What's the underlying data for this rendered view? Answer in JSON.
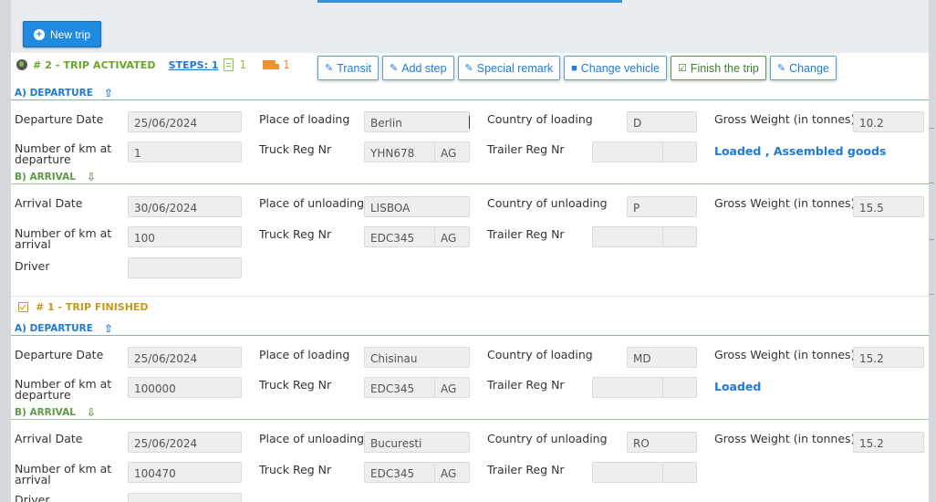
{
  "toolbar": {
    "new_trip": "New trip"
  },
  "trip2": {
    "title": "# 2 - TRIP ACTIVATED",
    "steps": "STEPS: 1",
    "docs_count": "1",
    "vehicles_count": "1",
    "actions": [
      "Transit",
      "Add step",
      "Special remark",
      "Change vehicle",
      "Finish the trip",
      "Change"
    ]
  },
  "sections": {
    "departure": "A) DEPARTURE",
    "arrival": "B) ARRIVAL"
  },
  "labels": {
    "departure_date": "Departure Date",
    "place_loading": "Place of loading",
    "country_loading": "Country of loading",
    "gross_weight": "Gross Weight (in tonnes)",
    "km_departure_1": "Number of km at",
    "km_departure_2": "departure",
    "truck_reg": "Truck Reg Nr",
    "trailer_reg": "Trailer Reg Nr",
    "arrival_date": "Arrival Date",
    "place_unloading": "Place of unloading",
    "country_unloading": "Country of unloading",
    "km_arrival_1": "Number of km at",
    "km_arrival_2": "arrival",
    "driver": "Driver",
    "driver_partial": "Driver"
  },
  "trip2_departure": {
    "date": "25/06/2024",
    "place": "Berlin",
    "country": "D",
    "weight": "10.2",
    "km": "1",
    "truck": "YHN678",
    "truck_cc": "AG",
    "trailer": "",
    "trailer_cc": "",
    "cargo": "Loaded , Assembled goods"
  },
  "trip2_arrival": {
    "date": "30/06/2024",
    "place": "LISBOA",
    "country": "P",
    "weight": "15.5",
    "km": "100",
    "truck": "EDC345",
    "truck_cc": "AG",
    "trailer": "",
    "trailer_cc": "",
    "driver": ""
  },
  "trip1": {
    "title": "# 1 - TRIP FINISHED"
  },
  "trip1_departure": {
    "date": "25/06/2024",
    "place": "Chisinau",
    "country": "MD",
    "weight": "15.2",
    "km": "100000",
    "truck": "EDC345",
    "truck_cc": "AG",
    "trailer": "",
    "trailer_cc": "",
    "cargo": "Loaded"
  },
  "trip1_arrival": {
    "date": "25/06/2024",
    "place": "Bucuresti",
    "country": "RO",
    "weight": "15.2",
    "km": "100470",
    "truck": "EDC345",
    "truck_cc": "AG",
    "trailer": "",
    "trailer_cc": ""
  }
}
